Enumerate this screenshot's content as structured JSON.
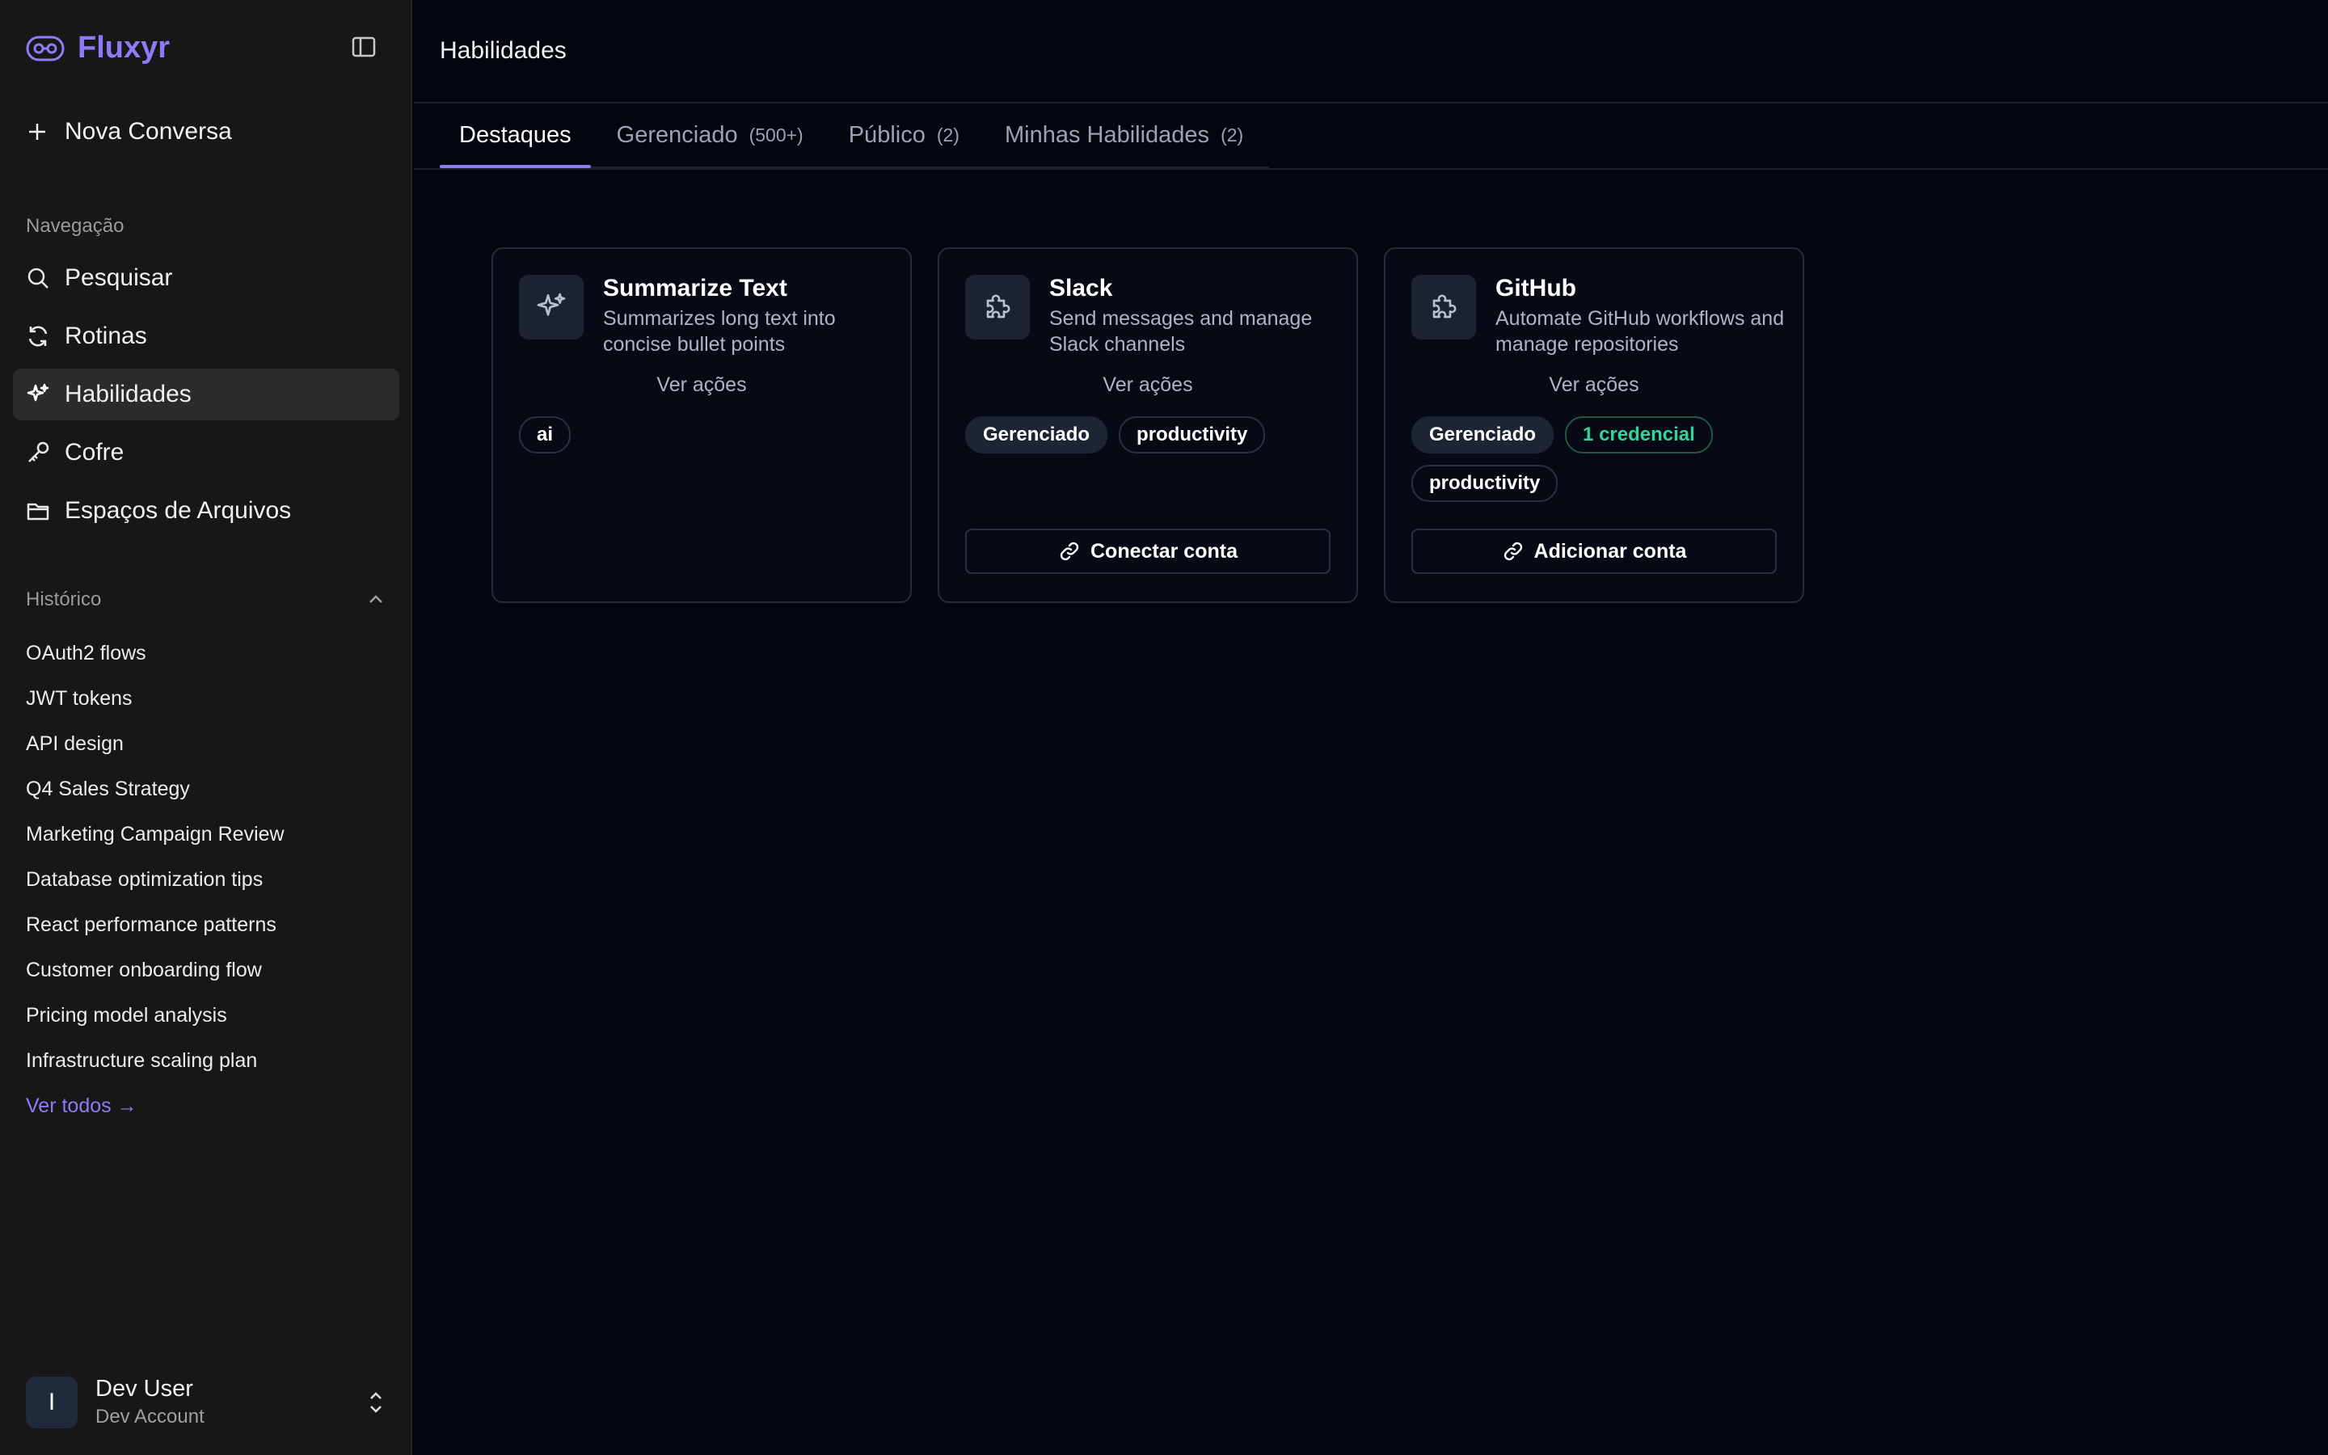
{
  "app": {
    "name": "Fluxyr"
  },
  "sidebar": {
    "new_chat_label": "Nova Conversa",
    "nav_label": "Navegação",
    "nav_items": [
      {
        "label": "Pesquisar",
        "icon": "search-icon"
      },
      {
        "label": "Rotinas",
        "icon": "refresh-icon"
      },
      {
        "label": "Habilidades",
        "icon": "sparkle-icon",
        "active": true
      },
      {
        "label": "Cofre",
        "icon": "key-icon"
      },
      {
        "label": "Espaços de Arquivos",
        "icon": "folder-icon"
      }
    ],
    "history_label": "Histórico",
    "history_items": [
      "OAuth2 flows",
      "JWT tokens",
      "API design",
      "Q4 Sales Strategy",
      "Marketing Campaign Review",
      "Database optimization tips",
      "React performance patterns",
      "Customer onboarding flow",
      "Pricing model analysis",
      "Infrastructure scaling plan"
    ],
    "view_all_label": "Ver todos →",
    "user": {
      "initial": "I",
      "name": "Dev User",
      "account": "Dev Account"
    }
  },
  "main": {
    "title": "Habilidades",
    "tabs": [
      {
        "label": "Destaques",
        "count": "",
        "active": true
      },
      {
        "label": "Gerenciado",
        "count": "(500+)"
      },
      {
        "label": "Público",
        "count": "(2)"
      },
      {
        "label": "Minhas Habilidades",
        "count": "(2)"
      }
    ],
    "cards": [
      {
        "title": "Summarize Text",
        "description": "Summarizes long text into concise bullet points",
        "icon": "sparkle-icon",
        "view_actions": "Ver ações",
        "tags": [
          "ai"
        ],
        "button": ""
      },
      {
        "title": "Slack",
        "description": "Send messages and manage Slack channels",
        "icon": "puzzle-icon",
        "view_actions": "Ver ações",
        "tags": [
          "Gerenciado",
          "productivity"
        ],
        "button": "Conectar conta"
      },
      {
        "title": "GitHub",
        "description": "Automate GitHub workflows and manage repositories",
        "icon": "puzzle-icon",
        "view_actions": "Ver ações",
        "tags": [
          "Gerenciado",
          "1 credencial",
          "productivity"
        ],
        "button": "Adicionar conta"
      }
    ]
  },
  "colors": {
    "accent": "#8b7cf6",
    "sidebar_bg": "#171717",
    "main_bg": "#04060f",
    "credential_green": "#34d399"
  }
}
